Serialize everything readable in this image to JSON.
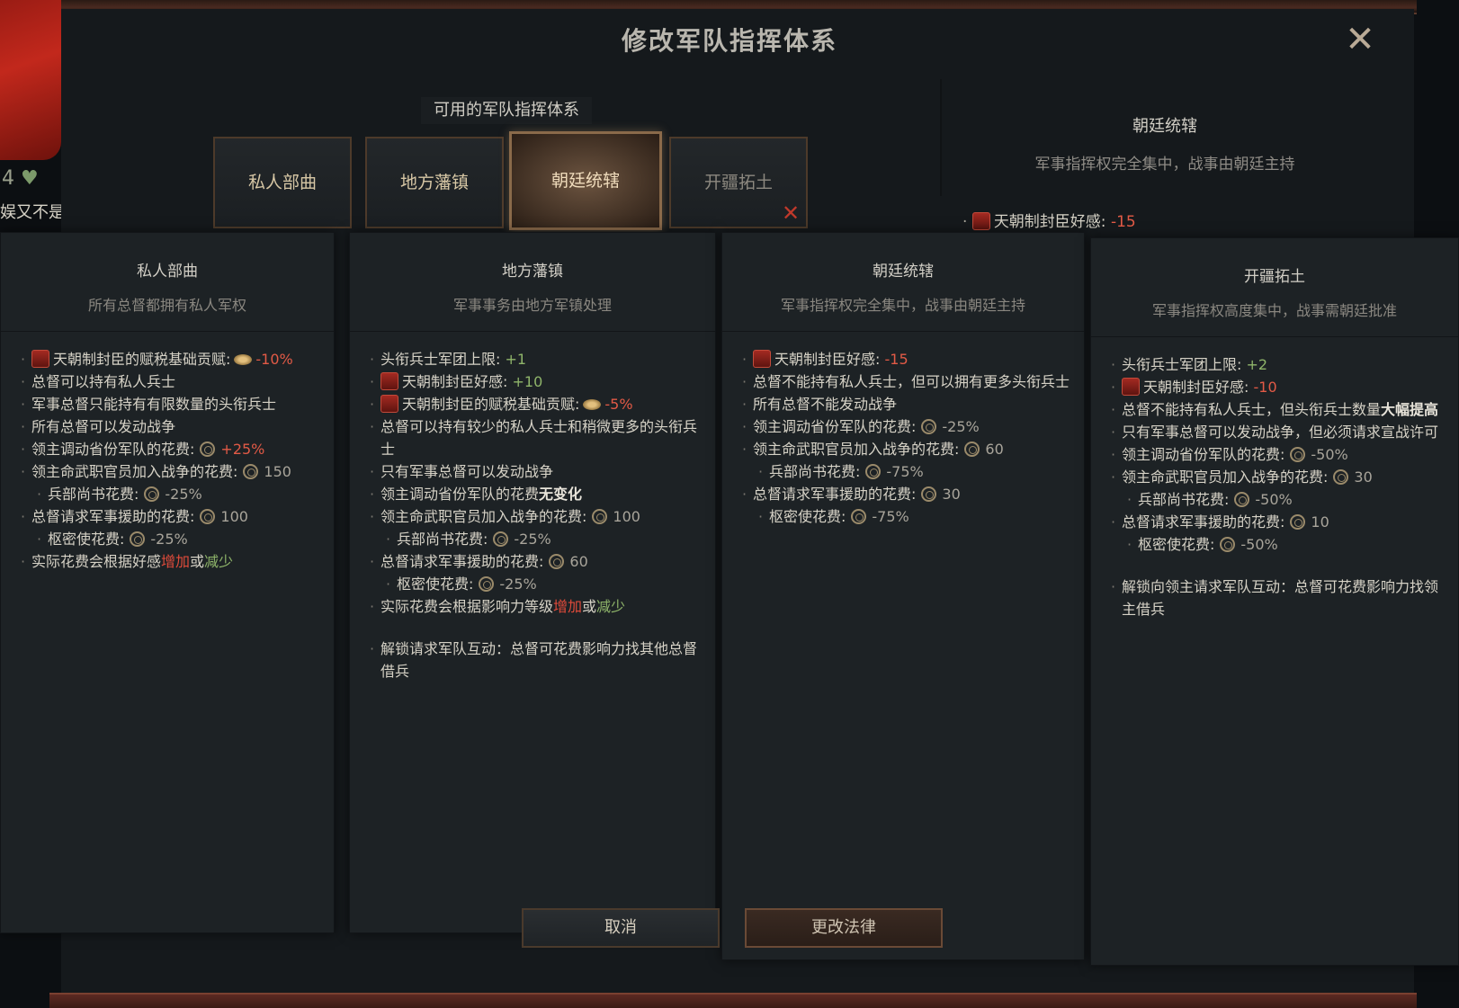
{
  "window": {
    "title": "修改军队指挥体系"
  },
  "left_panel": {
    "stat": "4",
    "note": "娱又不是"
  },
  "tabs": {
    "label": "可用的军队指挥体系",
    "items": [
      {
        "label": "私人部曲"
      },
      {
        "label": "地方藩镇"
      },
      {
        "label": "朝廷统辖"
      },
      {
        "label": "开疆拓土"
      }
    ]
  },
  "summary": {
    "title": "朝廷统辖",
    "desc": "军事指挥权完全集中，战事由朝廷主持",
    "effect_label": "天朝制封臣好感:",
    "effect_value": "-15"
  },
  "columns": [
    {
      "title": "私人部曲",
      "desc": "所有总督都拥有私人军权",
      "lines": {
        "l1_label": "天朝制封臣的赋税基础贡赋:",
        "l1_value": "-10%",
        "l2": "总督可以持有私人兵士",
        "l3": "军事总督只能持有有限数量的头衔兵士",
        "l4": "所有总督可以发动战争",
        "l5_label": "领主调动省份军队的花费:",
        "l5_value": "+25%",
        "l6_label": "领主命武职官员加入战争的花费:",
        "l6_value": "150",
        "l7_label": "兵部尚书花费:",
        "l7_value": "-25%",
        "l8_label": "总督请求军事援助的花费:",
        "l8_value": "100",
        "l9_label": "枢密使花费:",
        "l9_value": "-25%",
        "l10_a": "实际花费会根据好感",
        "l10_inc": "增加",
        "l10_or": "或",
        "l10_dec": "减少"
      }
    },
    {
      "title": "地方藩镇",
      "desc": "军事事务由地方军镇处理",
      "lines": {
        "l1_label": "头衔兵士军团上限:",
        "l1_value": "+1",
        "l2_label": "天朝制封臣好感:",
        "l2_value": "+10",
        "l3_label": "天朝制封臣的赋税基础贡赋:",
        "l3_value": "-5%",
        "l4": "总督可以持有较少的私人兵士和稍微更多的头衔兵士",
        "l5": "只有军事总督可以发动战争",
        "l6_label": "领主调动省份军队的花费",
        "l6_bold": "无变化",
        "l7_label": "领主命武职官员加入战争的花费:",
        "l7_value": "100",
        "l8_label": "兵部尚书花费:",
        "l8_value": "-25%",
        "l9_label": "总督请求军事援助的花费:",
        "l9_value": "60",
        "l10_label": "枢密使花费:",
        "l10_value": "-25%",
        "l11_a": "实际花费会根据影响力等级",
        "l11_inc": "增加",
        "l11_or": "或",
        "l11_dec": "减少",
        "l12": "解锁请求军队互动：总督可花费影响力找其他总督借兵"
      }
    },
    {
      "title": "朝廷统辖",
      "desc": "军事指挥权完全集中，战事由朝廷主持",
      "lines": {
        "l1_label": "天朝制封臣好感:",
        "l1_value": "-15",
        "l2": "总督不能持有私人兵士，但可以拥有更多头衔兵士",
        "l3": "所有总督不能发动战争",
        "l4_label": "领主调动省份军队的花费:",
        "l4_value": "-25%",
        "l5_label": "领主命武职官员加入战争的花费:",
        "l5_value": "60",
        "l6_label": "兵部尚书花费:",
        "l6_value": "-75%",
        "l7_label": "总督请求军事援助的花费:",
        "l7_value": "30",
        "l8_label": "枢密使花费:",
        "l8_value": "-75%"
      }
    },
    {
      "title": "开疆拓土",
      "desc": "军事指挥权高度集中，战事需朝廷批准",
      "lines": {
        "l1_label": "头衔兵士军团上限:",
        "l1_value": "+2",
        "l2_label": "天朝制封臣好感:",
        "l2_value": "-10",
        "l3_a": "总督不能持有私人兵士，但头衔兵士数量",
        "l3_bold": "大幅提高",
        "l4": "只有军事总督可以发动战争，但必须请求宣战许可",
        "l5_label": "领主调动省份军队的花费:",
        "l5_value": "-50%",
        "l6_label": "领主命武职官员加入战争的花费:",
        "l6_value": "30",
        "l7_label": "兵部尚书花费:",
        "l7_value": "-50%",
        "l8_label": "总督请求军事援助的花费:",
        "l8_value": "10",
        "l9_label": "枢密使花费:",
        "l9_value": "-50%",
        "l10": "解锁向领主请求军队互动：总督可花费影响力找领主借兵"
      }
    }
  ],
  "buttons": {
    "cancel": "取消",
    "confirm": "更改法律"
  },
  "colors": {
    "negative": "#e25a46",
    "positive": "#8fb56a",
    "accent": "#8a6a4a"
  },
  "icons": [
    "seal-icon",
    "coin-icon",
    "influence-icon",
    "heart-icon",
    "close-icon",
    "cross-icon"
  ]
}
